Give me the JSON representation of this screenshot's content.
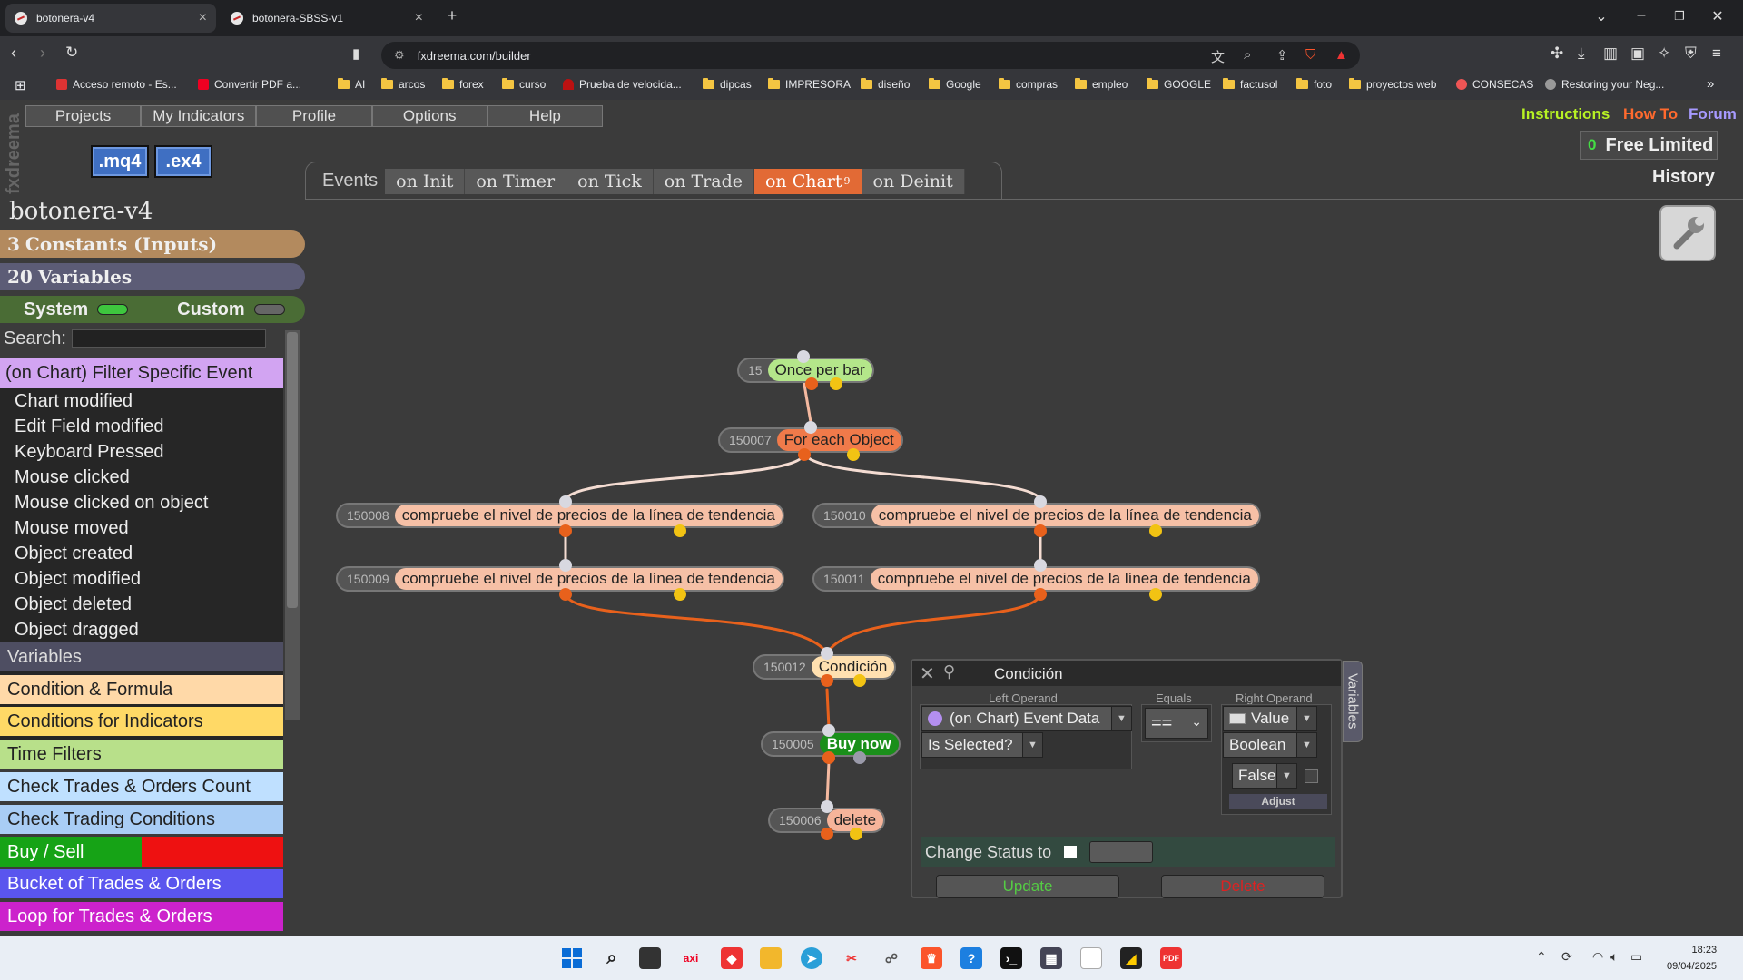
{
  "browser": {
    "tabs": [
      {
        "title": "botonera-v4",
        "active": true
      },
      {
        "title": "botonera-SBSS-v1",
        "active": false
      }
    ],
    "new_tab": "+",
    "url": "fxdreema.com/builder",
    "bookmarks": [
      {
        "label": "Acceso remoto - Es...",
        "icon": "remote-icon"
      },
      {
        "label": "Convertir PDF a...",
        "icon": "pdf-icon"
      },
      {
        "label": "AI",
        "icon": "folder-icon"
      },
      {
        "label": "arcos",
        "icon": "folder-icon"
      },
      {
        "label": "forex",
        "icon": "folder-icon"
      },
      {
        "label": "curso",
        "icon": "folder-icon"
      },
      {
        "label": "Prueba de velocida...",
        "icon": "speed-icon"
      },
      {
        "label": "dipcas",
        "icon": "folder-icon"
      },
      {
        "label": "IMPRESORA",
        "icon": "folder-icon"
      },
      {
        "label": "diseño",
        "icon": "folder-icon"
      },
      {
        "label": "Google",
        "icon": "folder-icon"
      },
      {
        "label": "compras",
        "icon": "folder-icon"
      },
      {
        "label": "empleo",
        "icon": "folder-icon"
      },
      {
        "label": "GOOGLE",
        "icon": "folder-icon"
      },
      {
        "label": "factusol",
        "icon": "folder-icon"
      },
      {
        "label": "foto",
        "icon": "folder-icon"
      },
      {
        "label": "proyectos web",
        "icon": "folder-icon"
      },
      {
        "label": "CONSECAS",
        "icon": "consecas-icon"
      },
      {
        "label": "Restoring your Neg...",
        "icon": "globe-icon"
      }
    ],
    "more_bookmarks": "»"
  },
  "app": {
    "menu": [
      "Projects",
      "My Indicators",
      "Profile",
      "Options",
      "Help"
    ],
    "links": {
      "instructions": "Instructions",
      "howto": "How To",
      "forum": "Forum"
    },
    "side_label": "fxdreema",
    "mq4": ".mq4",
    "ex4": ".ex4",
    "free_count": "0",
    "free_label": "Free Limited",
    "history": "History",
    "events_label": "Events",
    "event_tabs": [
      {
        "label": "on Init",
        "badge": ""
      },
      {
        "label": "on Timer",
        "badge": ""
      },
      {
        "label": "on Tick",
        "badge": ""
      },
      {
        "label": "on Trade",
        "badge": ""
      },
      {
        "label": "on Chart",
        "badge": "9"
      },
      {
        "label": "on Deinit",
        "badge": ""
      }
    ]
  },
  "sidebar": {
    "project_title": "botonera-v4",
    "constants": {
      "count": "3",
      "label": "Constants (Inputs)"
    },
    "variables": {
      "count": "20",
      "label": "Variables"
    },
    "system": "System",
    "custom": "Custom",
    "search_label": "Search:",
    "category_header": "(on Chart) Filter Specific Event",
    "items": [
      "Chart modified",
      "Edit Field modified",
      "Keyboard Pressed",
      "Mouse clicked",
      "Mouse clicked on object",
      "Mouse moved",
      "Object created",
      "Object modified",
      "Object deleted",
      "Object dragged"
    ],
    "categories": [
      {
        "label": "Variables",
        "bg": "#4e4e62",
        "color": "#dddddd"
      },
      {
        "label": "Condition & Formula",
        "bg": "#ffd9a8",
        "color": "#222222"
      },
      {
        "label": "Conditions for Indicators",
        "bg": "#ffd966",
        "color": "#222222"
      },
      {
        "label": "Time Filters",
        "bg": "#b8e08a",
        "color": "#222222"
      },
      {
        "label": "Check Trades & Orders Count",
        "bg": "#bfe0ff",
        "color": "#222222"
      },
      {
        "label": "Check Trading Conditions",
        "bg": "#a9cdf5",
        "color": "#222222"
      }
    ],
    "buy_sell": "Buy / Sell",
    "categories2": [
      {
        "label": "Bucket of Trades & Orders",
        "bg": "#5a55ee",
        "color": "#ffffff"
      },
      {
        "label": "Loop for Trades & Orders",
        "bg": "#cc22cc",
        "color": "#ffffff"
      }
    ]
  },
  "blocks": [
    {
      "id": "15",
      "label": "Once per bar",
      "color": "#b4e68a"
    },
    {
      "id": "150007",
      "label": "For each Object",
      "color": "#f07a4a"
    },
    {
      "id": "150008",
      "label": "compruebe el nivel de precios de la línea de tendencia",
      "color": "#f6c0a6"
    },
    {
      "id": "150010",
      "label": "compruebe el nivel de precios de la línea de tendencia",
      "color": "#f6c0a6"
    },
    {
      "id": "150009",
      "label": "compruebe el nivel de precios de la línea de tendencia",
      "color": "#f6c0a6"
    },
    {
      "id": "150011",
      "label": "compruebe el nivel de precios de la línea de tendencia",
      "color": "#f6c0a6"
    },
    {
      "id": "150012",
      "label": "Condición",
      "color": "#ffe0b0"
    },
    {
      "id": "150005",
      "label": "Buy now",
      "color": "#1a8f1a"
    },
    {
      "id": "150006",
      "label": "delete",
      "color": "#f6b49a"
    }
  ],
  "dialog": {
    "title": "Condición",
    "left_head": "Left Operand",
    "equals_head": "Equals",
    "right_head": "Right Operand",
    "left_value": "(on Chart) Event Data",
    "left_sub": "Is Selected?",
    "operator": "==",
    "right_type": "Value",
    "right_kind": "Boolean",
    "right_value": "False",
    "adjust": "Adjust",
    "change_status": "Change Status to",
    "update": "Update",
    "delete": "Delete",
    "variables_tab": "Variables"
  },
  "taskbar": {
    "time": "18:23",
    "date": "09/04/2025"
  }
}
